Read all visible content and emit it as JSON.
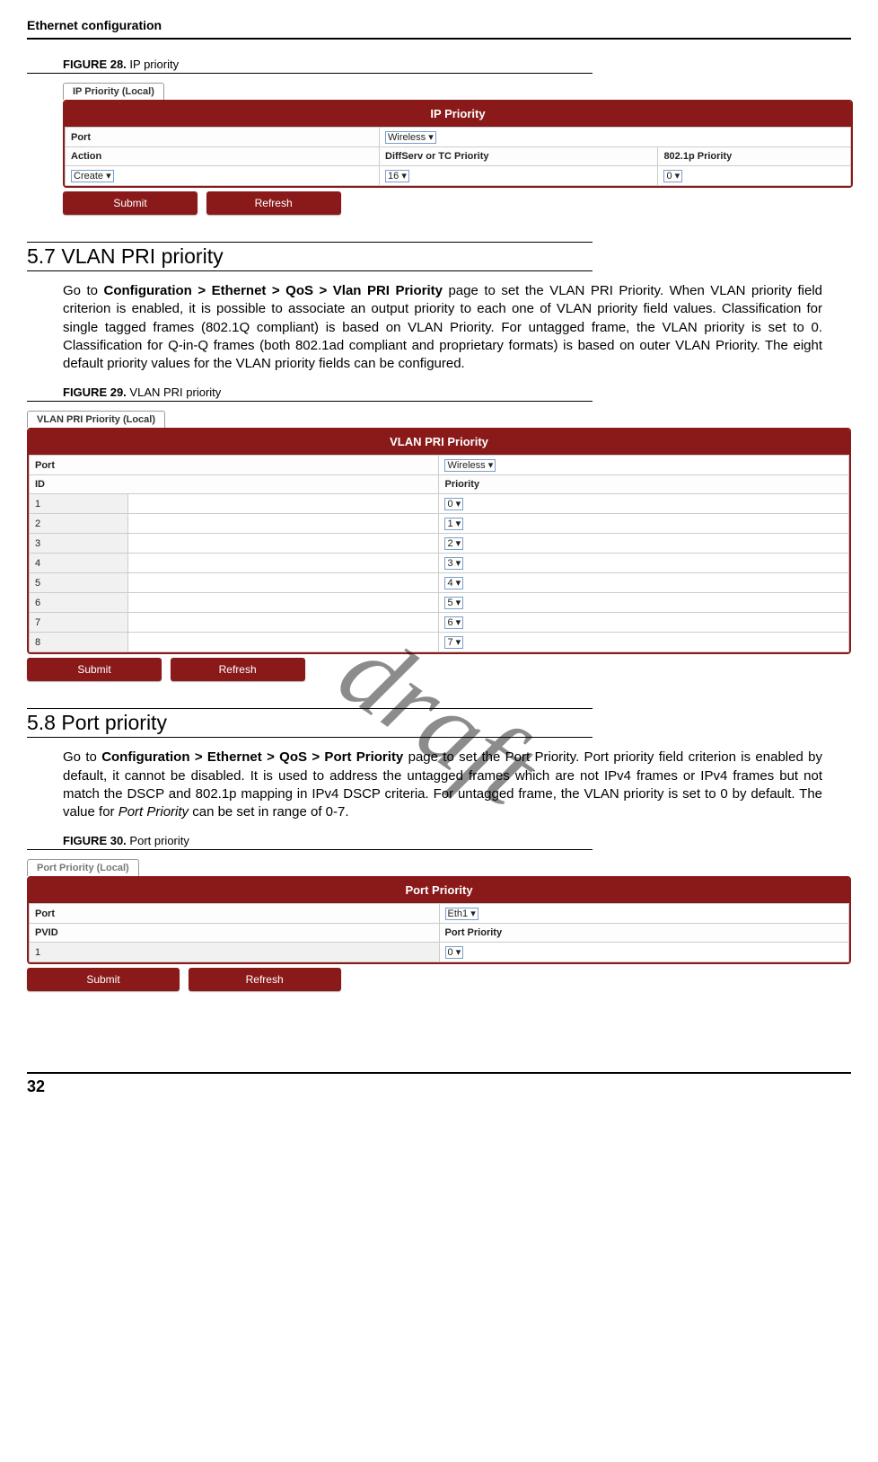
{
  "header": {
    "title": "Ethernet configuration"
  },
  "watermark": "draft",
  "fig28": {
    "caption_prefix": "FIGURE 28.",
    "caption_text": "IP priority",
    "tab": "IP Priority (Local)",
    "banner": "IP Priority",
    "col_port": "Port",
    "col_action": "Action",
    "col_diffserv": "DiffServ or TC Priority",
    "col_8021p": "802.1p Priority",
    "port_value": "Wireless",
    "action_value": "Create",
    "diffserv_value": "16",
    "p8021_value": "0",
    "btn_submit": "Submit",
    "btn_refresh": "Refresh"
  },
  "sec57": {
    "heading": "5.7 VLAN PRI priority",
    "body_pre": "Go to ",
    "body_bold": "Configuration > Ethernet > QoS > Vlan PRI Priority",
    "body_post": " page to set the VLAN PRI Priority. When VLAN priority field criterion is enabled, it is possible to associate an output priority to each one of VLAN priority field values. Classification for single tagged frames (802.1Q compliant) is based on VLAN Priority. For untagged frame, the VLAN priority is set to 0. Classification for Q-in-Q frames (both 802.1ad compliant and proprietary formats) is based on outer VLAN Priority. The eight default priority values for the VLAN priority fields can be configured."
  },
  "fig29": {
    "caption_prefix": "FIGURE 29.",
    "caption_text": "VLAN PRI priority",
    "tab": "VLAN PRI Priority (Local)",
    "banner": "VLAN PRI Priority",
    "col_port": "Port",
    "col_id": "ID",
    "col_priority": "Priority",
    "port_value": "Wireless",
    "rows": [
      {
        "id": "1",
        "priority": "0"
      },
      {
        "id": "2",
        "priority": "1"
      },
      {
        "id": "3",
        "priority": "2"
      },
      {
        "id": "4",
        "priority": "3"
      },
      {
        "id": "5",
        "priority": "4"
      },
      {
        "id": "6",
        "priority": "5"
      },
      {
        "id": "7",
        "priority": "6"
      },
      {
        "id": "8",
        "priority": "7"
      }
    ],
    "btn_submit": "Submit",
    "btn_refresh": "Refresh"
  },
  "sec58": {
    "heading": "5.8 Port priority",
    "body_pre": "Go to ",
    "body_bold": "Configuration > Ethernet > QoS > Port Priority",
    "body_mid": " page to set the Port Priority. Port priority field criterion is enabled by default, it cannot be disabled. It is used to address the untagged frames which are not IPv4 frames or IPv4 frames but not match the DSCP and 802.1p mapping in IPv4 DSCP criteria. For untagged frame, the VLAN priority is set to 0 by default. The value for ",
    "body_italic": "Port Priority",
    "body_post": " can be set in range of 0-7."
  },
  "fig30": {
    "caption_prefix": "FIGURE 30.",
    "caption_text": "Port priority",
    "tab": "Port Priority (Local)",
    "banner": "Port Priority",
    "col_port": "Port",
    "col_pvid": "PVID",
    "col_pp": "Port Priority",
    "port_value": "Eth1",
    "pvid_value": "1",
    "pp_value": "0",
    "btn_submit": "Submit",
    "btn_refresh": "Refresh"
  },
  "footer": {
    "page_number": "32"
  },
  "chevron": "▾"
}
